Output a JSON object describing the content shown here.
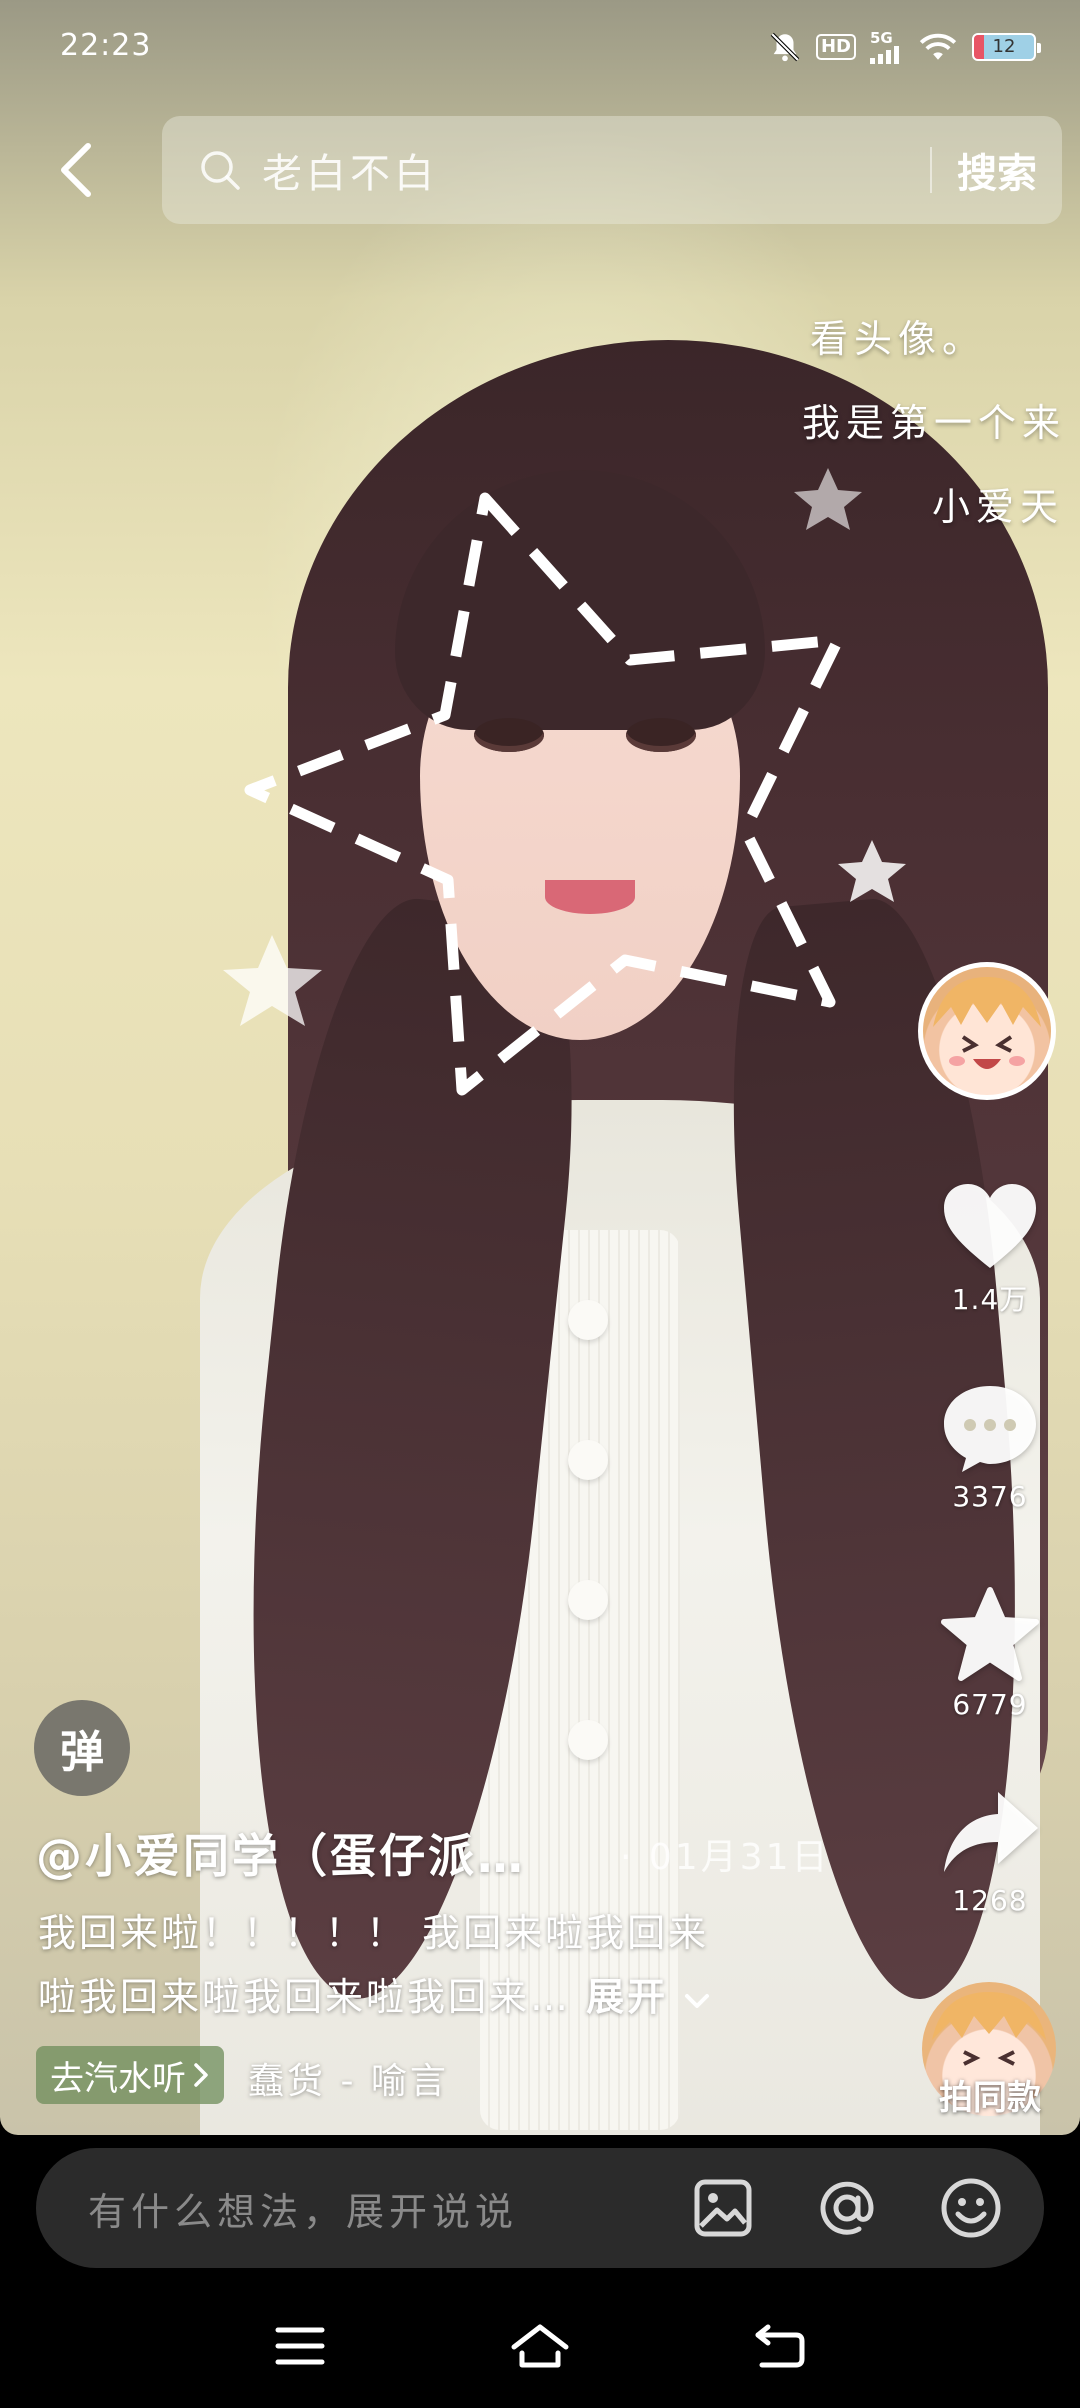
{
  "status_bar": {
    "time": "22:23",
    "network": "5G",
    "hd_label": "HD",
    "battery_level": "12"
  },
  "search": {
    "query": "老白不白",
    "button_label": "搜索"
  },
  "overlay_text": {
    "line1": "看头像。",
    "line2": "我是第一个来",
    "line3": "小爱天"
  },
  "actions": {
    "like_count": "1.4万",
    "comment_count": "3376",
    "favorite_count": "6779",
    "share_count": "1268",
    "same_style_label": "拍同款"
  },
  "post": {
    "danmaku_label": "弹",
    "author": "@小爱同学（蛋仔派…",
    "date": "· 01月31日",
    "caption_line1": "我回来啦！！！！！ 我回来啦我回来",
    "caption_line2": "啦我回来啦我回来啦我回来…",
    "expand_label": "展开",
    "music_tag_label": "去汽水听",
    "music_name": "蠢货 - 喻言"
  },
  "comment_bar": {
    "placeholder": "有什么想法，展开说说"
  },
  "colors": {
    "comment_bar_bg": "#2b2b2b",
    "music_tag_bg": "#6e8c5a"
  }
}
